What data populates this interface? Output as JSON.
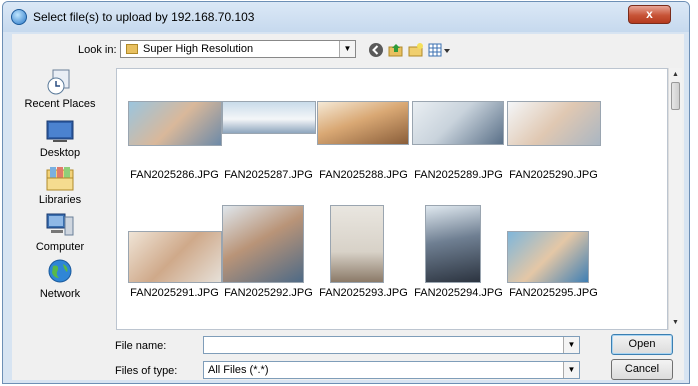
{
  "window": {
    "title": "Select file(s) to upload by 192.168.70.103",
    "close_label": "x"
  },
  "lookin": {
    "label": "Look in:",
    "value": "Super High Resolution"
  },
  "places": [
    {
      "label": "Recent Places",
      "icon": "recent-places-icon"
    },
    {
      "label": "Desktop",
      "icon": "desktop-icon"
    },
    {
      "label": "Libraries",
      "icon": "libraries-icon"
    },
    {
      "label": "Computer",
      "icon": "computer-icon"
    },
    {
      "label": "Network",
      "icon": "network-icon"
    }
  ],
  "files": [
    {
      "name": "FAN2025286.JPG"
    },
    {
      "name": "FAN2025287.JPG"
    },
    {
      "name": "FAN2025288.JPG"
    },
    {
      "name": "FAN2025289.JPG"
    },
    {
      "name": "FAN2025290.JPG"
    },
    {
      "name": "FAN2025291.JPG"
    },
    {
      "name": "FAN2025292.JPG"
    },
    {
      "name": "FAN2025293.JPG"
    },
    {
      "name": "FAN2025294.JPG"
    },
    {
      "name": "FAN2025295.JPG"
    }
  ],
  "filename": {
    "label": "File name:",
    "value": ""
  },
  "filetype": {
    "label": "Files of type:",
    "value": "All Files (*.*)"
  },
  "buttons": {
    "open": "Open",
    "cancel": "Cancel"
  },
  "colors": {
    "frame": "#d7e4f2",
    "close": "#c75437"
  }
}
